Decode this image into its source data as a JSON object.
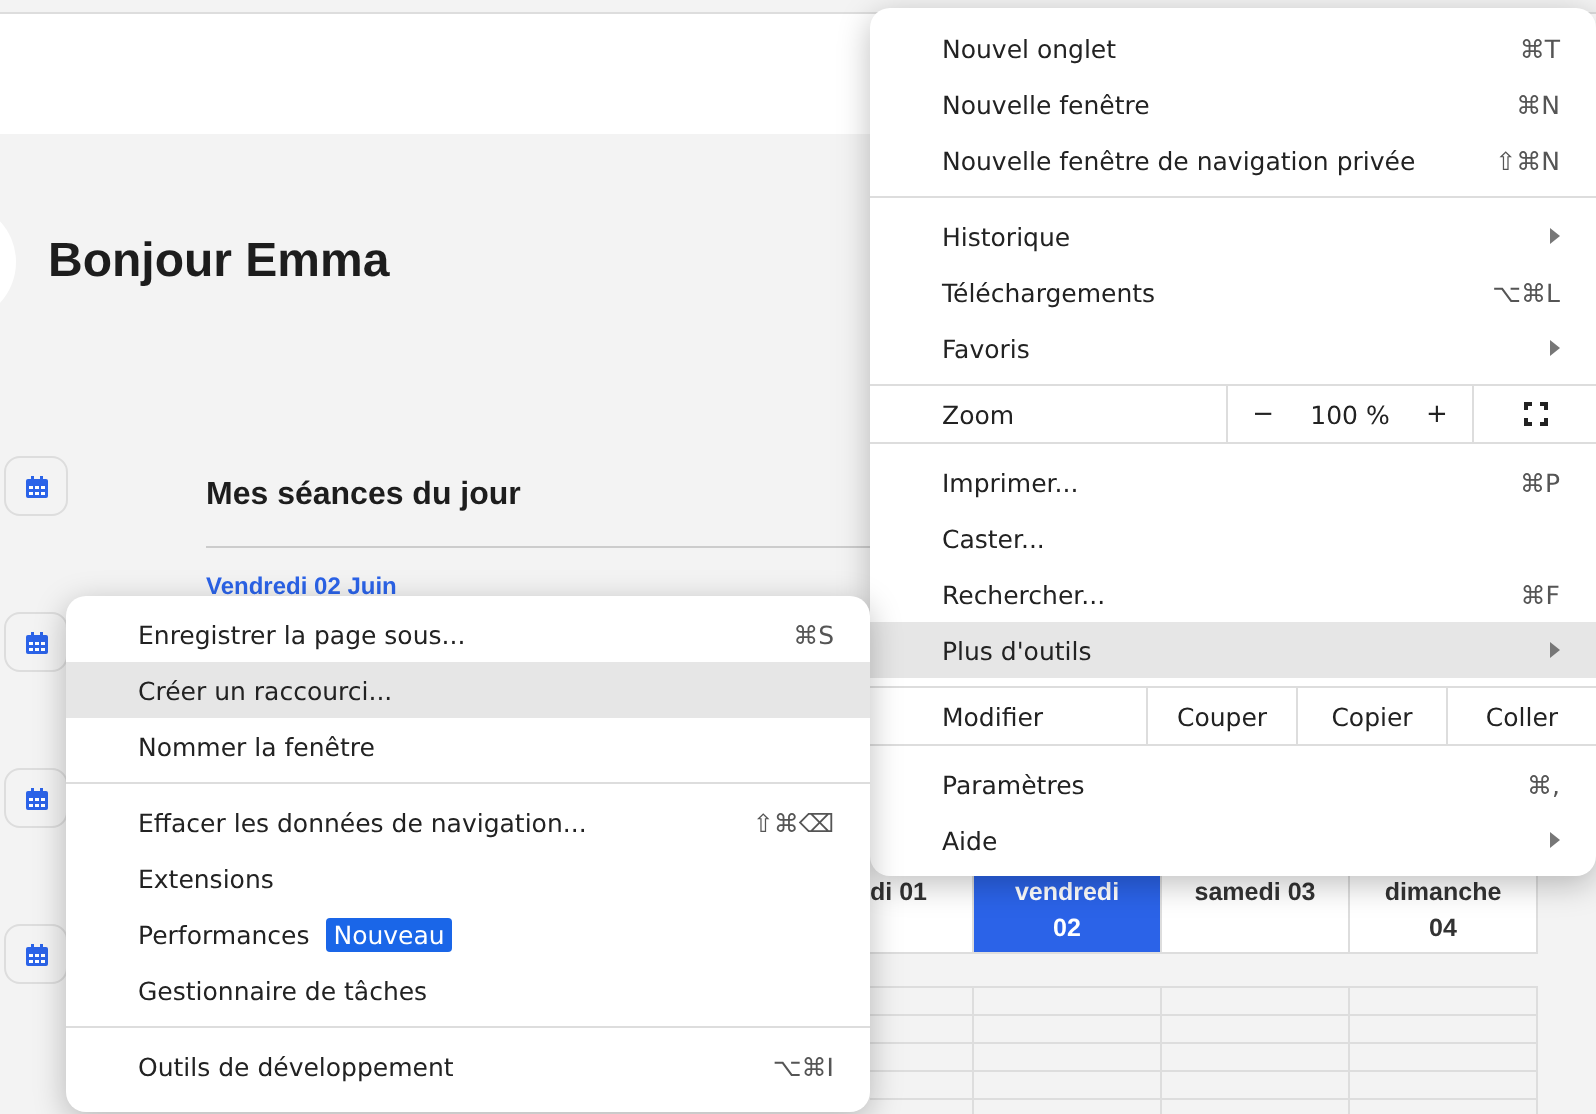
{
  "page": {
    "greeting": "Bonjour Emma",
    "section_title": "Mes séances du jour",
    "date_label": "Vendredi 02 Juin",
    "week_days": [
      {
        "label": "di 01",
        "selected": false
      },
      {
        "label": "vendredi 02",
        "selected": true
      },
      {
        "label": "samedi 03",
        "selected": false
      },
      {
        "label": "dimanche 04",
        "selected": false
      }
    ]
  },
  "main_menu": {
    "sections": [
      [
        {
          "kind": "item",
          "label": "Nouvel onglet",
          "shortcut": "⌘T",
          "submenu": false,
          "highlighted": false
        },
        {
          "kind": "item",
          "label": "Nouvelle fenêtre",
          "shortcut": "⌘N",
          "submenu": false,
          "highlighted": false
        },
        {
          "kind": "item",
          "label": "Nouvelle fenêtre de navigation privée",
          "shortcut": "⇧⌘N",
          "submenu": false,
          "highlighted": false
        }
      ],
      [
        {
          "kind": "item",
          "label": "Historique",
          "submenu": true,
          "highlighted": false
        },
        {
          "kind": "item",
          "label": "Téléchargements",
          "shortcut": "⌥⌘L",
          "submenu": false,
          "highlighted": false
        },
        {
          "kind": "item",
          "label": "Favoris",
          "submenu": true,
          "highlighted": false
        }
      ],
      [
        {
          "kind": "zoom",
          "label": "Zoom",
          "minus": "−",
          "value": "100 %",
          "plus": "+"
        }
      ],
      [
        {
          "kind": "item",
          "label": "Imprimer...",
          "shortcut": "⌘P",
          "submenu": false,
          "highlighted": false
        },
        {
          "kind": "item",
          "label": "Caster...",
          "submenu": false,
          "highlighted": false
        },
        {
          "kind": "item",
          "label": "Rechercher...",
          "shortcut": "⌘F",
          "submenu": false,
          "highlighted": false
        },
        {
          "kind": "item",
          "label": "Plus d'outils",
          "submenu": true,
          "highlighted": true
        }
      ],
      [
        {
          "kind": "edit",
          "label": "Modifier",
          "actions": [
            "Couper",
            "Copier",
            "Coller"
          ]
        }
      ],
      [
        {
          "kind": "item",
          "label": "Paramètres",
          "shortcut": "⌘,",
          "submenu": false,
          "highlighted": false
        },
        {
          "kind": "item",
          "label": "Aide",
          "submenu": true,
          "highlighted": false
        }
      ]
    ]
  },
  "sub_menu": {
    "sections": [
      [
        {
          "kind": "item",
          "label": "Enregistrer la page sous...",
          "shortcut": "⌘S",
          "highlighted": false
        },
        {
          "kind": "item",
          "label": "Créer un raccourci...",
          "highlighted": true
        },
        {
          "kind": "item",
          "label": "Nommer la fenêtre",
          "highlighted": false
        }
      ],
      [
        {
          "kind": "item",
          "label": "Effacer les données de navigation...",
          "shortcut": "⇧⌘⌫",
          "highlighted": false
        },
        {
          "kind": "item",
          "label": "Extensions",
          "highlighted": false
        },
        {
          "kind": "item",
          "label": "Performances",
          "badge": "Nouveau",
          "highlighted": false
        },
        {
          "kind": "item",
          "label": "Gestionnaire de tâches",
          "highlighted": false
        }
      ],
      [
        {
          "kind": "item",
          "label": "Outils de développement",
          "shortcut": "⌥⌘I",
          "highlighted": false
        }
      ]
    ]
  }
}
